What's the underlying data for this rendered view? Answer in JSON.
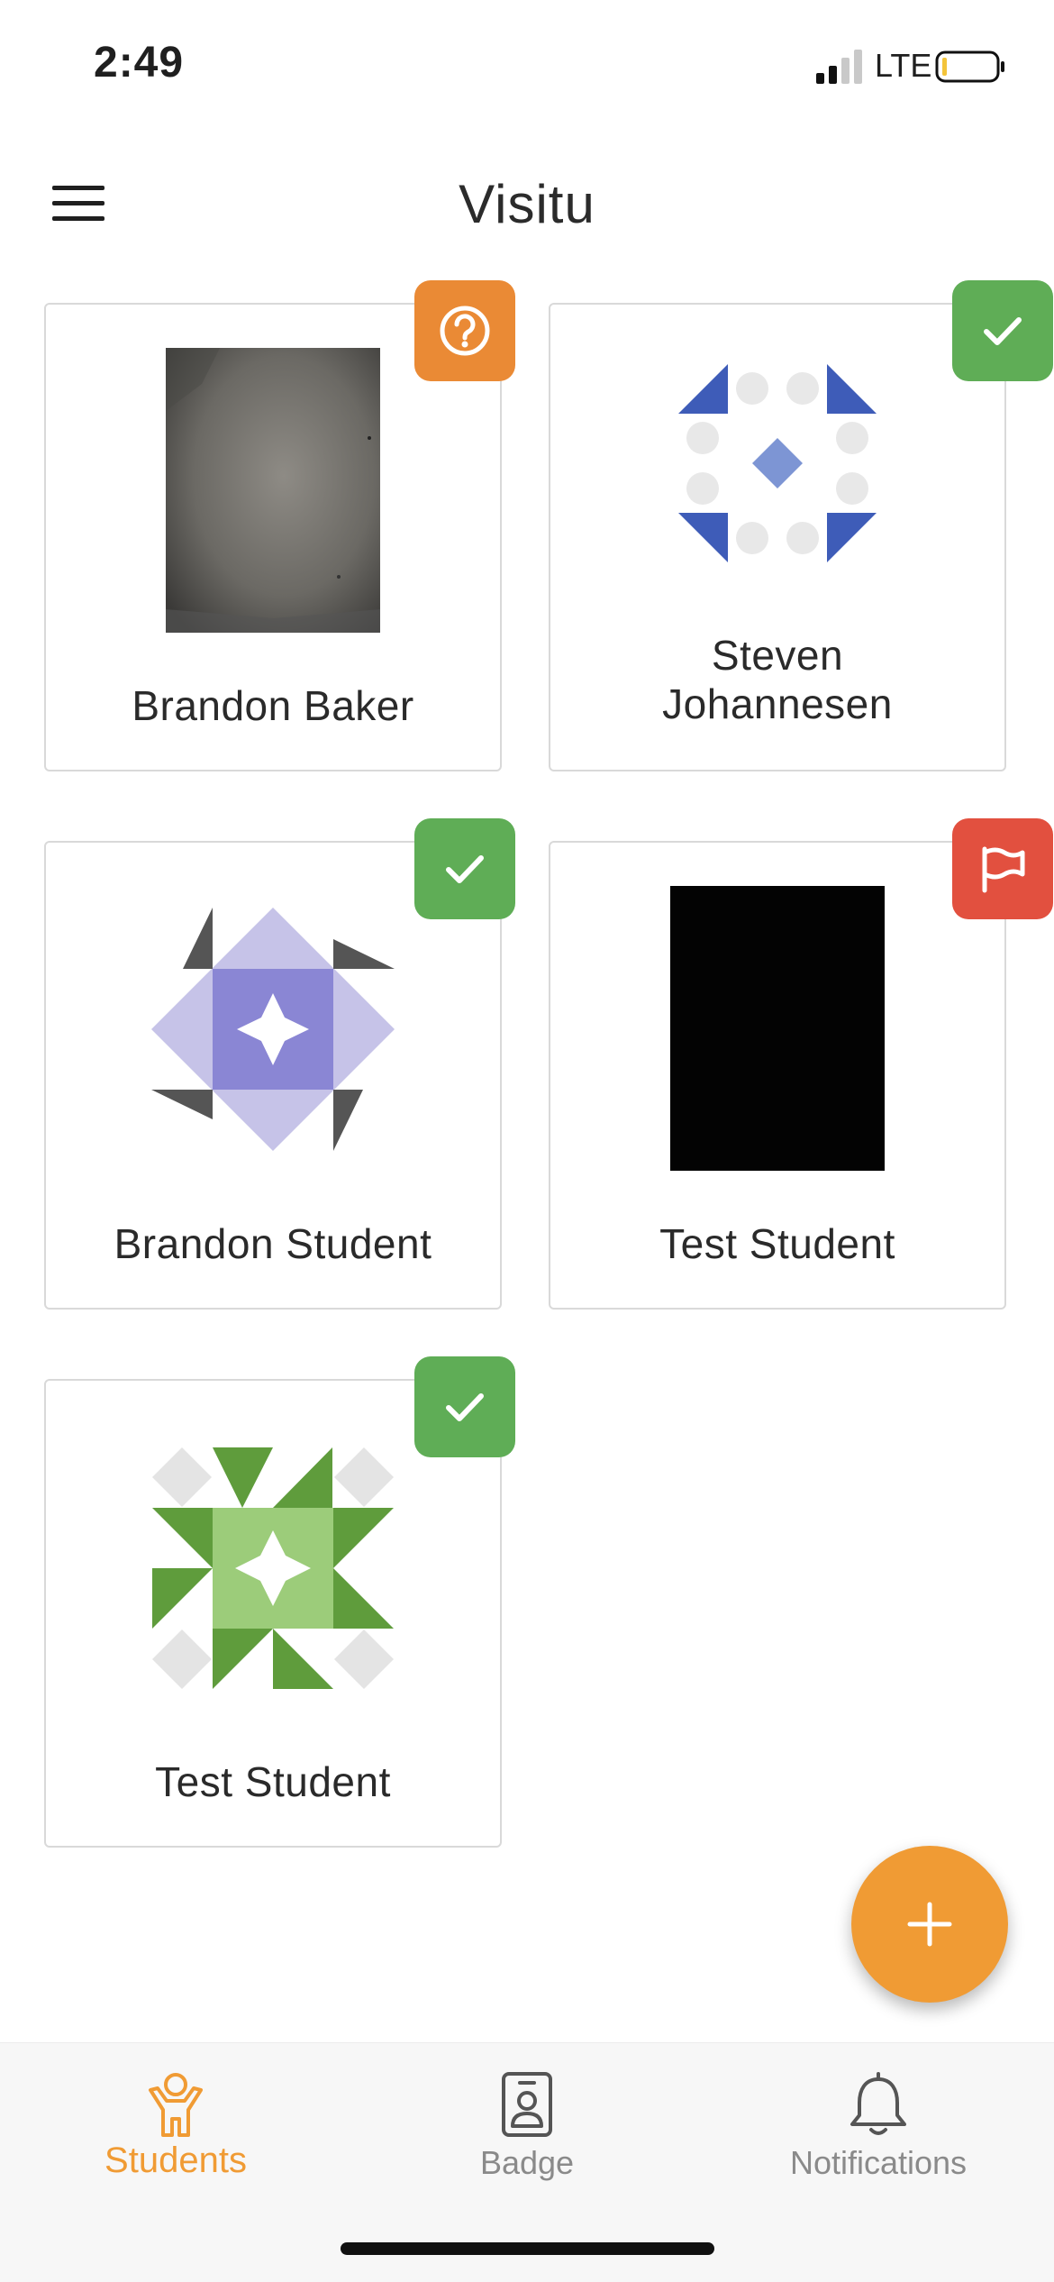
{
  "status_bar": {
    "time": "2:49",
    "network": "LTE"
  },
  "header": {
    "title": "Visitu",
    "menu_icon": "hamburger-menu-icon"
  },
  "students": [
    {
      "name": "Brandon Baker",
      "avatar": "photo-dim-gray",
      "status": "question",
      "status_color": "#ea8a35"
    },
    {
      "name": "Steven Johannesen",
      "avatar": "identicon-blue",
      "status": "check",
      "status_color": "#5fad56"
    },
    {
      "name": "Brandon Student",
      "avatar": "identicon-purple",
      "status": "check",
      "status_color": "#5fad56"
    },
    {
      "name": "Test Student",
      "avatar": "photo-black",
      "status": "flag",
      "status_color": "#e2503f"
    },
    {
      "name": "Test Student",
      "avatar": "identicon-green",
      "status": "check",
      "status_color": "#5fad56"
    }
  ],
  "fab": {
    "icon": "plus-icon",
    "color": "#f09b34"
  },
  "tabs": [
    {
      "label": "Students",
      "icon": "student-icon",
      "active": true
    },
    {
      "label": "Badge",
      "icon": "badge-icon",
      "active": false
    },
    {
      "label": "Notifications",
      "icon": "bell-icon",
      "active": false
    }
  ],
  "colors": {
    "accent": "#f09b34",
    "success": "#5fad56",
    "warning": "#ea8a35",
    "danger": "#e2503f"
  }
}
